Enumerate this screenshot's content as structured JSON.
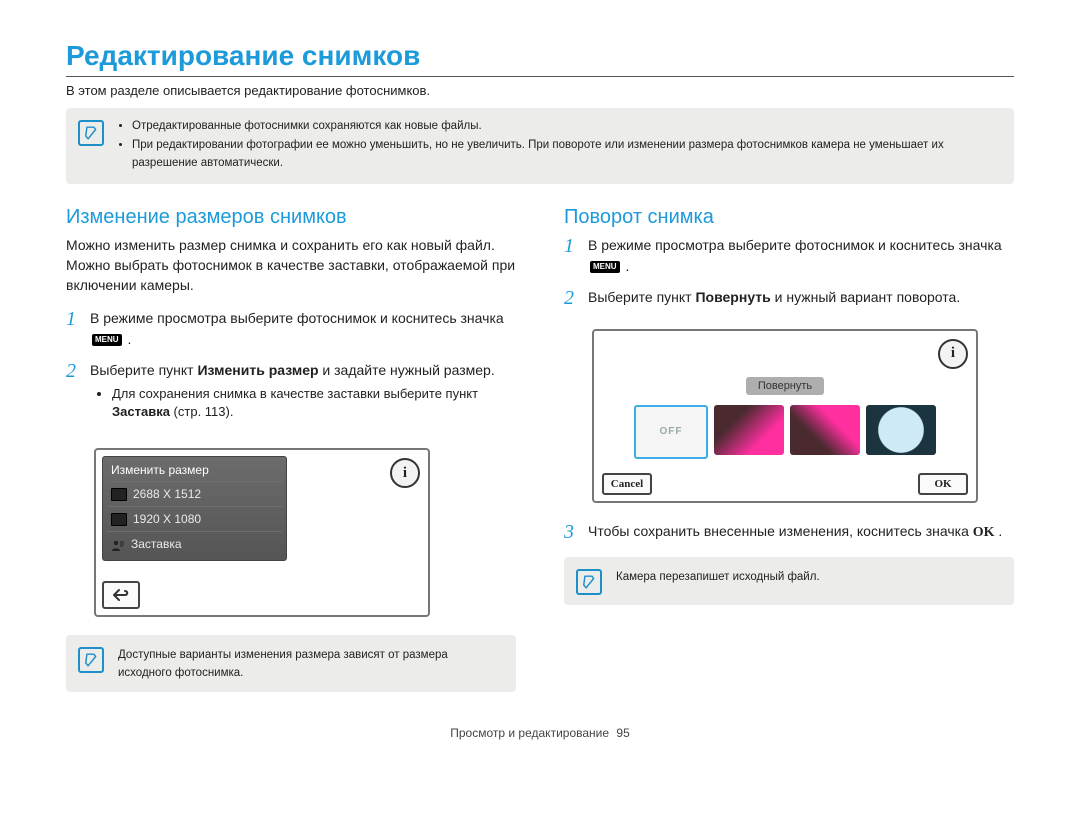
{
  "page_title": "Редактирование снимков",
  "intro": "В этом разделе описывается редактирование фотоснимков.",
  "top_notes": [
    "Отредактированные фотоснимки сохраняются как новые файлы.",
    "При редактировании фотографии ее можно уменьшить, но не увеличить. При повороте или изменении размера фотоснимков камера не уменьшает их разрешение автоматически."
  ],
  "menu_chip": "MENU",
  "left": {
    "title": "Изменение размеров снимков",
    "intro": "Можно изменить размер снимка и сохранить его как новый файл. Можно выбрать фотоснимок в качестве заставки, отображаемой при включении камеры.",
    "step1_a": "В режиме просмотра выберите фотоснимок и коснитесь значка ",
    "step1_b": ".",
    "step2_a": "Выберите пункт ",
    "step2_bold": "Изменить размер",
    "step2_b": " и задайте нужный размер.",
    "sub_a": "Для сохранения снимка в качестве заставки выберите пункт ",
    "sub_bold": "Заставка",
    "sub_b": " (стр. 113).",
    "panel_title": "Изменить размер",
    "opt1": "2688 X 1512",
    "opt2": "1920 X 1080",
    "opt3": "Заставка",
    "note": "Доступные варианты изменения размера зависят от размера исходного фотоснимка."
  },
  "right": {
    "title": "Поворот снимка",
    "step1_a": "В режиме просмотра выберите фотоснимок и коснитесь значка ",
    "step1_b": ".",
    "step2_a": "Выберите пункт ",
    "step2_bold": "Повернуть",
    "step2_b": " и нужный вариант поворота.",
    "rotate_label": "Повернуть",
    "off_label": "OFF",
    "cancel": "Cancel",
    "ok": "OK",
    "step3_a": "Чтобы сохранить внесенные изменения, коснитесь значка ",
    "step3_ok": "OK",
    "step3_b": ".",
    "note": "Камера перезапишет исходный файл."
  },
  "footer": {
    "section": "Просмотр и редактирование",
    "page": "95"
  }
}
